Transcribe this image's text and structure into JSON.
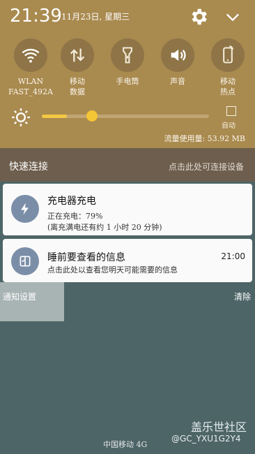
{
  "status": {
    "time": "21:39",
    "date": "11月23日, 星期三"
  },
  "tiles": [
    {
      "label": "WLAN\nFAST_492A",
      "icon": "wifi-icon"
    },
    {
      "label": "移动\n数据",
      "icon": "mobile-data-icon"
    },
    {
      "label": "手电筒",
      "icon": "flashlight-icon"
    },
    {
      "label": "声音",
      "icon": "sound-icon"
    },
    {
      "label": "移动\n热点",
      "icon": "hotspot-icon"
    }
  ],
  "brightness": {
    "level": 0.15,
    "auto_label": "自动"
  },
  "data_usage": "流量使用量: 53.92 MB",
  "quick_connect": {
    "title": "快速连接",
    "hint": "点击此处可连接设备"
  },
  "notifications": [
    {
      "title": "充电器充电",
      "line1": "正在充电：79%",
      "line2": "(离充满电还有约 1 小时 20 分钟)",
      "icon": "lightning-icon"
    },
    {
      "title": "睡前要查看的信息",
      "line1": "点击此处以查看您明天可能需要的信息",
      "time": "21:00",
      "icon": "briefing-icon"
    }
  ],
  "footer": {
    "notify_settings": "通知设置",
    "clear": "清除",
    "carrier": "中国移动 4G"
  },
  "watermark": {
    "brand": "盖乐世社区",
    "user": "@GC_YXU1G2Y4"
  },
  "colors": {
    "panel": "#a98a4f",
    "accent": "#f4c535",
    "background": "#4d6567"
  }
}
